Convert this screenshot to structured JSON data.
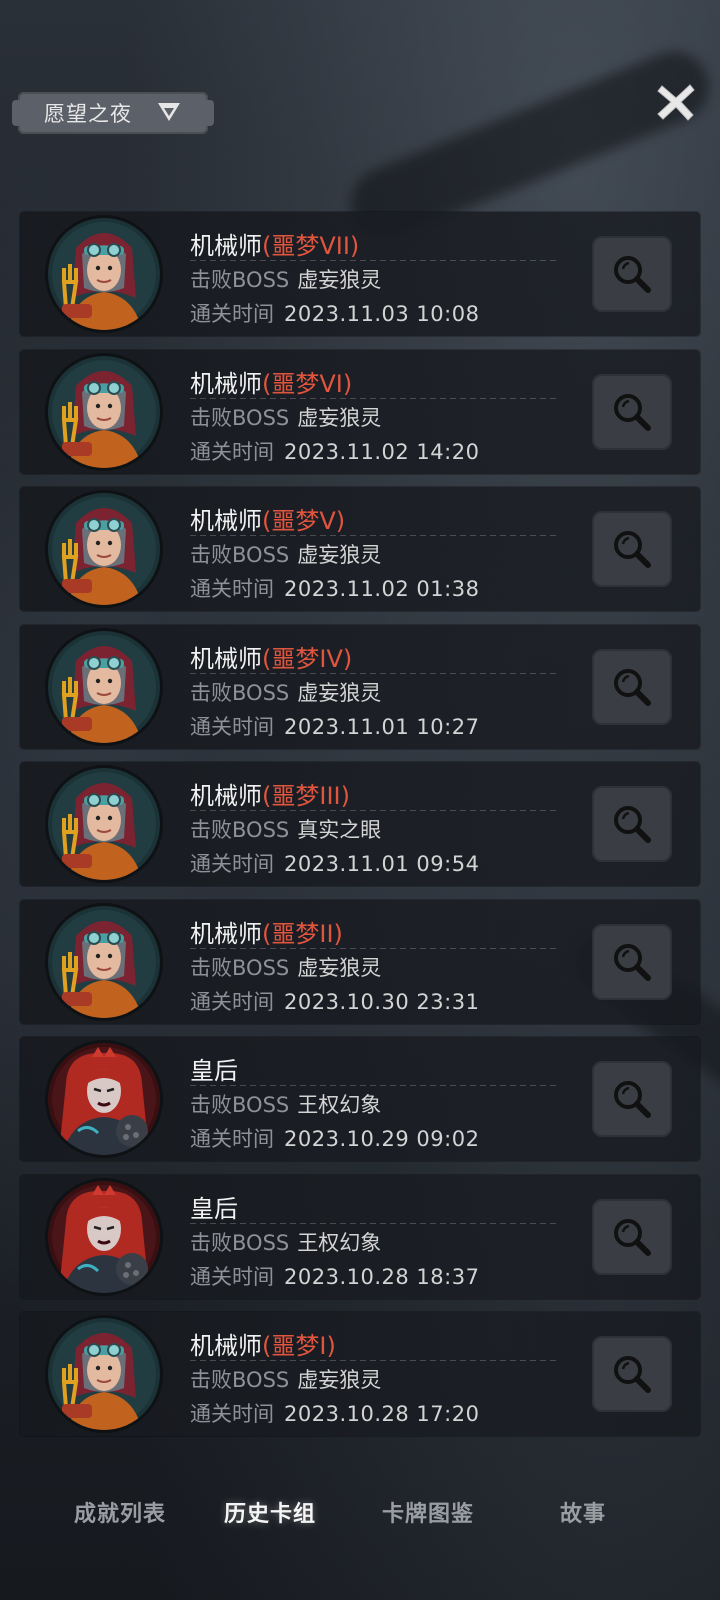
{
  "header": {
    "selector_label": "愿望之夜",
    "selector_icon": "dropdown-triangle-icon",
    "close_icon": "close-icon"
  },
  "labels": {
    "boss_prefix": "击败BOSS",
    "time_prefix": "通关时间",
    "view_icon": "magnifier-icon"
  },
  "records": [
    {
      "character": "机械师",
      "difficulty": "(噩梦VII)",
      "boss": "虚妄狼灵",
      "time": "2023.11.03 10:08",
      "avatar": "mechanic"
    },
    {
      "character": "机械师",
      "difficulty": "(噩梦VI)",
      "boss": "虚妄狼灵",
      "time": "2023.11.02 14:20",
      "avatar": "mechanic"
    },
    {
      "character": "机械师",
      "difficulty": "(噩梦V)",
      "boss": "虚妄狼灵",
      "time": "2023.11.02 01:38",
      "avatar": "mechanic"
    },
    {
      "character": "机械师",
      "difficulty": "(噩梦IV)",
      "boss": "虚妄狼灵",
      "time": "2023.11.01 10:27",
      "avatar": "mechanic"
    },
    {
      "character": "机械师",
      "difficulty": "(噩梦III)",
      "boss": "真实之眼",
      "time": "2023.11.01 09:54",
      "avatar": "mechanic"
    },
    {
      "character": "机械师",
      "difficulty": "(噩梦II)",
      "boss": "虚妄狼灵",
      "time": "2023.10.30 23:31",
      "avatar": "mechanic"
    },
    {
      "character": "皇后",
      "difficulty": "",
      "boss": "王权幻象",
      "time": "2023.10.29 09:02",
      "avatar": "queen"
    },
    {
      "character": "皇后",
      "difficulty": "",
      "boss": "王权幻象",
      "time": "2023.10.28 18:37",
      "avatar": "queen"
    },
    {
      "character": "机械师",
      "difficulty": "(噩梦I)",
      "boss": "虚妄狼灵",
      "time": "2023.10.28 17:20",
      "avatar": "mechanic"
    }
  ],
  "tabs": [
    {
      "label": "成就列表",
      "active": false
    },
    {
      "label": "历史卡组",
      "active": true
    },
    {
      "label": "卡牌图鉴",
      "active": false
    },
    {
      "label": "故事",
      "active": false
    }
  ],
  "colors": {
    "difficulty": "#e0553e",
    "card_bg": "#1a1d23",
    "text_primary": "#f2f2f2",
    "text_secondary": "#8e9298"
  }
}
